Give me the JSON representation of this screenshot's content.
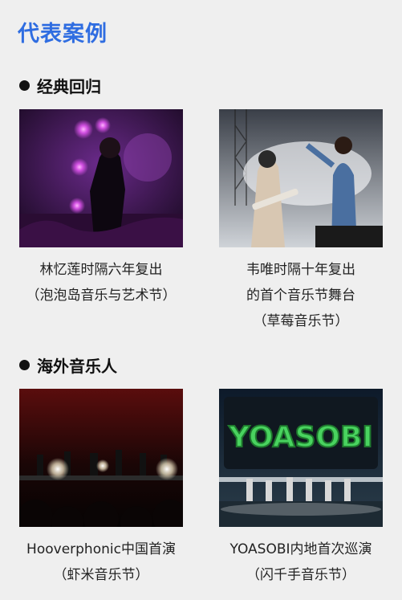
{
  "page": {
    "title": "代表案例"
  },
  "sections": [
    {
      "heading": "经典回归",
      "cards": [
        {
          "caption_lines": [
            "林忆莲时隔六年复出",
            "（泡泡岛音乐与艺术节）"
          ]
        },
        {
          "caption_lines": [
            "韦唯时隔十年复出",
            "的首个音乐节舞台",
            "（草莓音乐节）"
          ]
        }
      ]
    },
    {
      "heading": "海外音乐人",
      "cards": [
        {
          "caption_lines": [
            "Hooverphonic中国首演",
            "（虾米音乐节）"
          ]
        },
        {
          "caption_lines": [
            "YOASOBI内地首次巡演",
            "（闪千手音乐节）"
          ]
        }
      ]
    }
  ],
  "images": {
    "yoasobi_banner_text": "YOASOBI"
  }
}
